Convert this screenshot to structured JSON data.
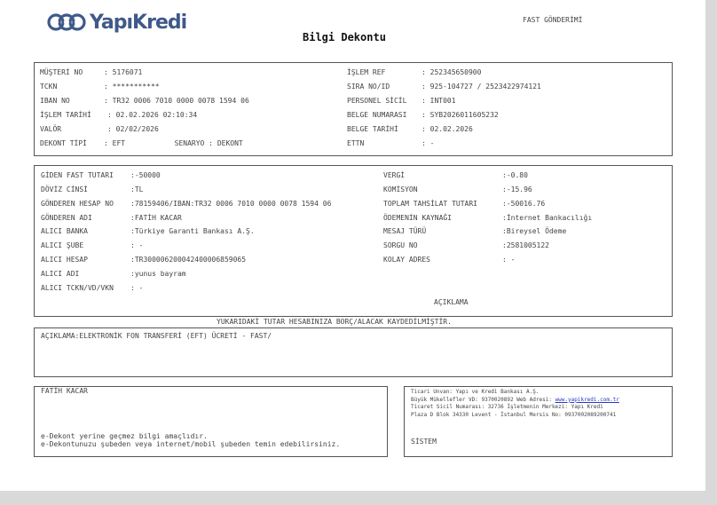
{
  "header": {
    "logo_text": "YapıKredi",
    "logo_icon": "yapikredi-logo-icon",
    "brand_color": "#3f5a8a",
    "title": "Bilgi Dekontu",
    "transfer_type": "FAST GÖNDERİMİ"
  },
  "customer": {
    "musteri_no_label": "MÜŞTERİ NO",
    "musteri_no": "5176071",
    "tckn_label": "TCKN",
    "tckn": "***********",
    "iban_label": "IBAN NO",
    "iban": "TR32 0006 7010 0000 0078 1594 06",
    "islem_tarihi_label": "İŞLEM TARİHİ",
    "islem_tarihi": "02.02.2026 02:10:34",
    "valor_label": "VALÖR",
    "valor": "02/02/2026",
    "dekont_tipi_label": "DEKONT TİPİ",
    "dekont_tipi": "EFT",
    "senaryo_label": "SENARYO",
    "senaryo": "DEKONT",
    "islem_ref_label": "İŞLEM REF",
    "islem_ref": "252345650900",
    "sira_label": "SIRA NO/ID",
    "sira": "925-104727 / 2523422974121",
    "personel_label": "PERSONEL SİCİL",
    "personel": "INT001",
    "belge_no_label": "BELGE NUMARASI",
    "belge_no": "SYB2026011605232",
    "belge_tarihi_label": "BELGE TARİHİ",
    "belge_tarihi": "02.02.2026",
    "ettn_label": "ETTN",
    "ettn": "-"
  },
  "transfer": {
    "tutar_label": "GİDEN FAST TUTARI",
    "tutar": "-50000",
    "doviz_label": "DÖVİZ CİNSİ",
    "doviz": "TL",
    "gonderen_hesap_label": "GÖNDEREN HESAP NO",
    "gonderen_hesap": "78159406/IBAN:TR32 0006 7010 0000 0078 1594 06",
    "gonderen_adi_label": "GÖNDEREN ADI",
    "gonderen_adi": "FATİH KACAR",
    "alici_banka_label": "ALICI BANKA",
    "alici_banka": "Türkiye Garanti Bankası A.Ş.",
    "alici_sube_label": "ALICI ŞUBE",
    "alici_sube": "-",
    "alici_hesap_label": "ALICI HESAP",
    "alici_hesap": "TR300006200042400006859065",
    "alici_adi_label": "ALICI ADI",
    "alici_adi": "yunus bayram",
    "alici_tckn_label": "ALICI TCKN/VD/VKN",
    "alici_tckn": "-",
    "vergi_label": "VERGİ",
    "vergi": "-0.80",
    "komisyon_label": "KOMİSYON",
    "komisyon": "-15.96",
    "toplam_label": "TOPLAM TAHSİLAT TUTARI",
    "toplam": "-50016.76",
    "odeme_kaynagi_label": "ÖDEMENİN KAYNAĞI",
    "odeme_kaynagi": "İnternet Bankacılığı",
    "mesaj_turu_label": "MESAJ TÜRÜ",
    "mesaj_turu": "Bireysel Ödeme",
    "sorgu_label": "SORGU NO",
    "sorgu": "2581005122",
    "kolay_label": "KOLAY ADRES",
    "kolay": "-",
    "aciklama_header": "AÇIKLAMA"
  },
  "notice": "YUKARIDAKİ TUTAR HESABINIZA BORÇ/ALACAK KAYDEDİLMİŞTİR.",
  "description": "AÇIKLAMA:ELEKTRONİK FON TRANSFERİ (EFT) ÜCRETİ - FAST/",
  "footer_left": {
    "name": "FATİH KACAR",
    "line1": "e-Dekont yerine geçmez bilgi amaçlıdır.",
    "line2": "e-Dekontunuzu şubeden veya internet/mobil şubeden temin edebilirsiniz."
  },
  "footer_right": {
    "l1": "Ticari Unvan: Yapı ve Kredi Bankası A.Ş.",
    "l2_prefix": "Büyük Mükellefler VD: 9370020892 Web Adresi: ",
    "l2_link": "www.yapikredi.com.tr",
    "l3": "Ticaret Sicil Numarası: 32736 İşletmenin Merkezi: Yapı Kredi",
    "l4": "Plaza D Blok 34330 Levent - İstanbul Mersis No: 0937002089200741",
    "sistem": "SİSTEM"
  }
}
